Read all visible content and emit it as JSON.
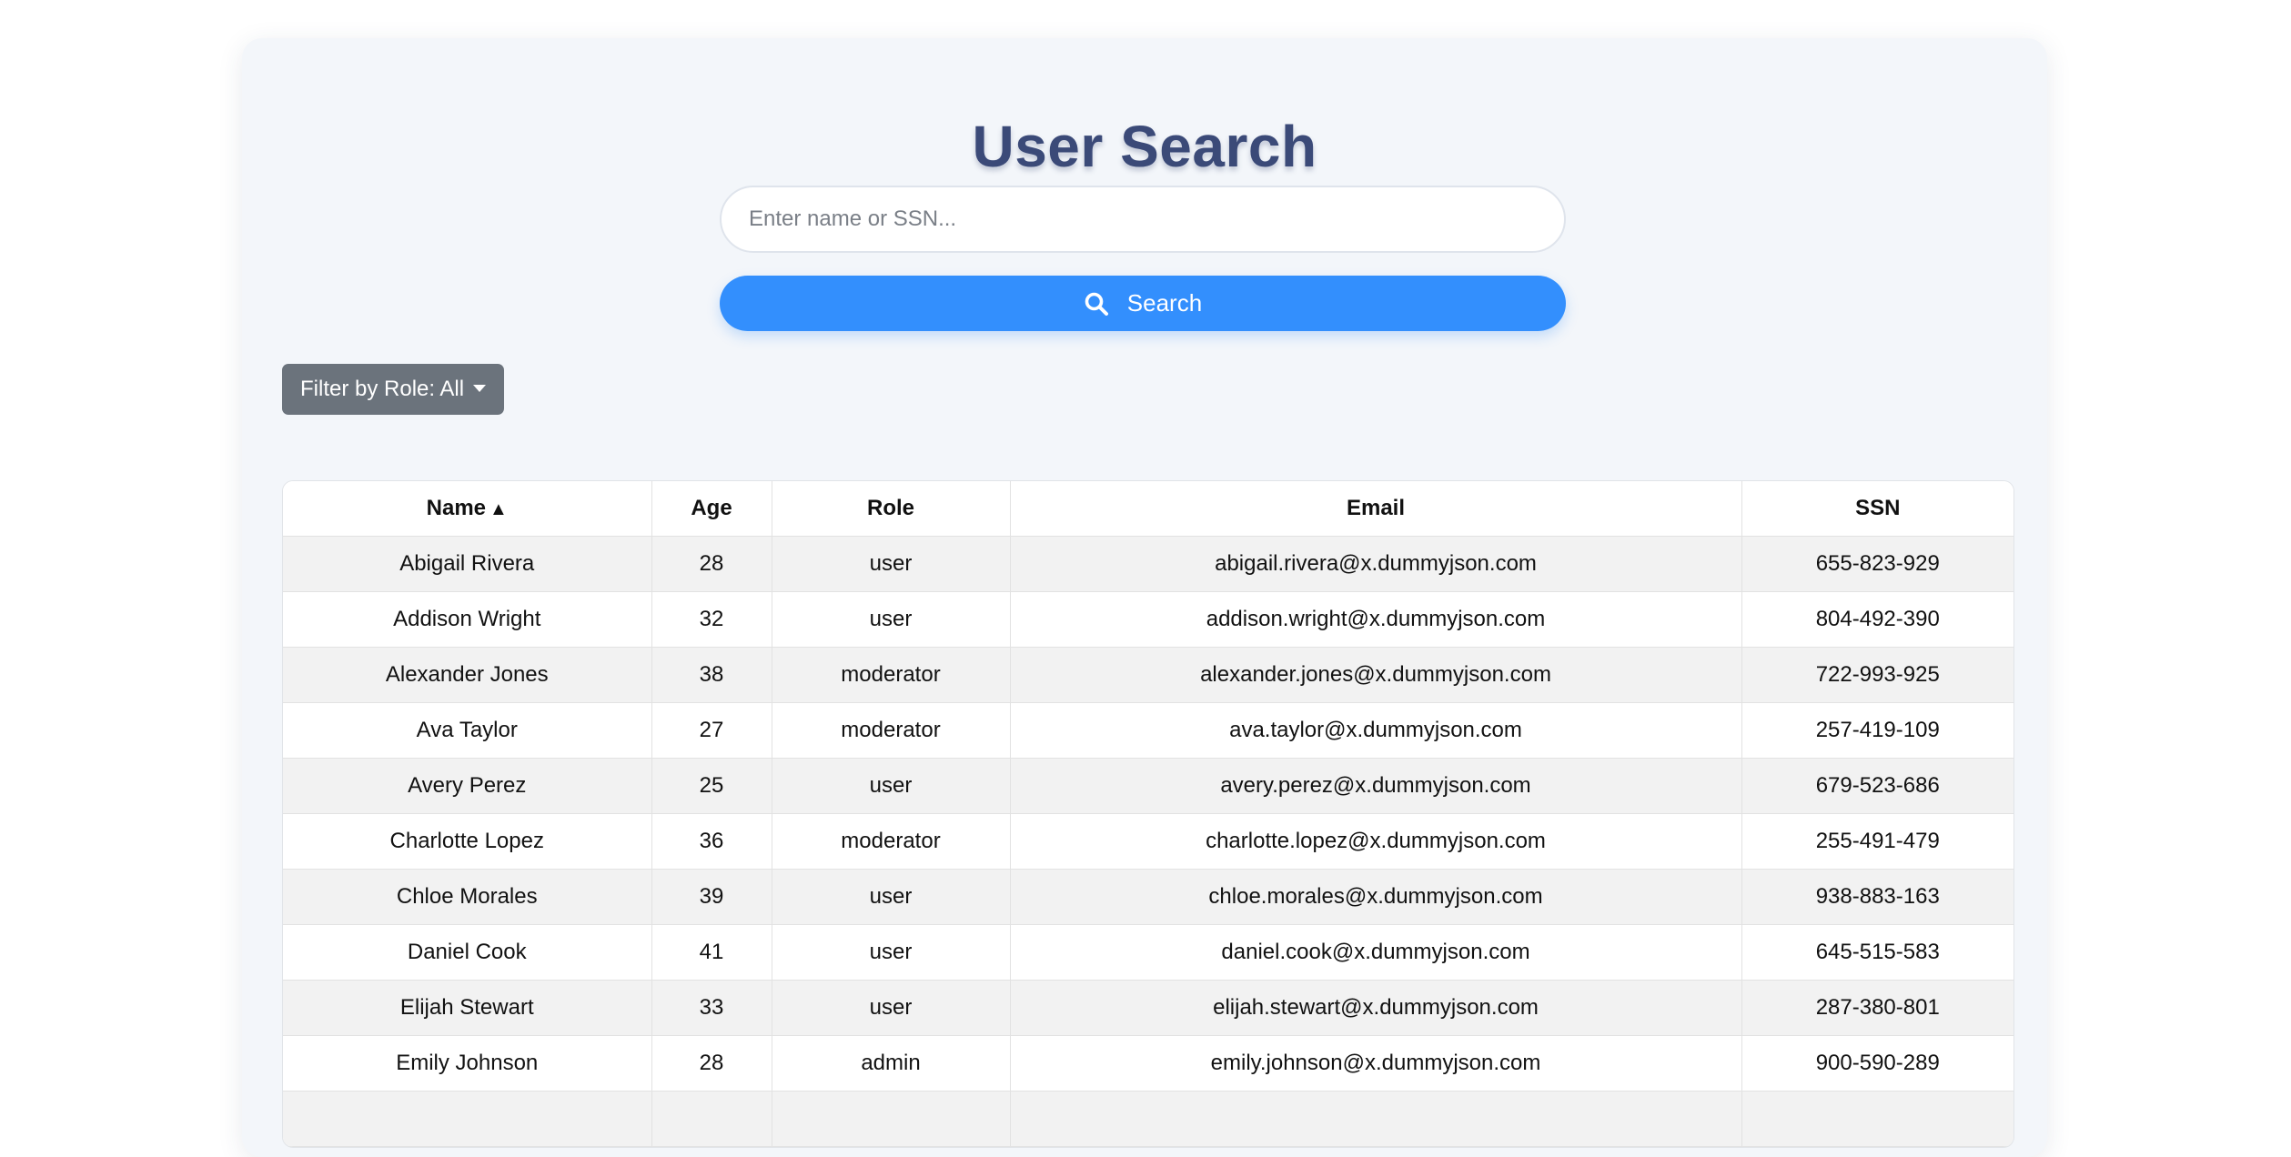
{
  "page": {
    "title": "User Search"
  },
  "search": {
    "placeholder": "Enter name or SSN...",
    "value": "",
    "button_label": "Search",
    "icon": "search-icon"
  },
  "filter": {
    "label": "Filter by Role: All"
  },
  "table": {
    "columns": [
      {
        "label": "Name",
        "sort": "▲"
      },
      {
        "label": "Age"
      },
      {
        "label": "Role"
      },
      {
        "label": "Email"
      },
      {
        "label": "SSN"
      }
    ],
    "rows": [
      {
        "name": "Abigail Rivera",
        "age": "28",
        "role": "user",
        "email": "abigail.rivera@x.dummyjson.com",
        "ssn": "655-823-929"
      },
      {
        "name": "Addison Wright",
        "age": "32",
        "role": "user",
        "email": "addison.wright@x.dummyjson.com",
        "ssn": "804-492-390"
      },
      {
        "name": "Alexander Jones",
        "age": "38",
        "role": "moderator",
        "email": "alexander.jones@x.dummyjson.com",
        "ssn": "722-993-925"
      },
      {
        "name": "Ava Taylor",
        "age": "27",
        "role": "moderator",
        "email": "ava.taylor@x.dummyjson.com",
        "ssn": "257-419-109"
      },
      {
        "name": "Avery Perez",
        "age": "25",
        "role": "user",
        "email": "avery.perez@x.dummyjson.com",
        "ssn": "679-523-686"
      },
      {
        "name": "Charlotte Lopez",
        "age": "36",
        "role": "moderator",
        "email": "charlotte.lopez@x.dummyjson.com",
        "ssn": "255-491-479"
      },
      {
        "name": "Chloe Morales",
        "age": "39",
        "role": "user",
        "email": "chloe.morales@x.dummyjson.com",
        "ssn": "938-883-163"
      },
      {
        "name": "Daniel Cook",
        "age": "41",
        "role": "user",
        "email": "daniel.cook@x.dummyjson.com",
        "ssn": "645-515-583"
      },
      {
        "name": "Elijah Stewart",
        "age": "33",
        "role": "user",
        "email": "elijah.stewart@x.dummyjson.com",
        "ssn": "287-380-801"
      },
      {
        "name": "Emily Johnson",
        "age": "28",
        "role": "admin",
        "email": "emily.johnson@x.dummyjson.com",
        "ssn": "900-590-289"
      },
      {
        "name": "",
        "age": "",
        "role": "",
        "email": "",
        "ssn": ""
      }
    ]
  },
  "colors": {
    "title": "#3b4a78",
    "accent": "#338ffd",
    "filter_button": "#6b737c",
    "card_background": "#f3f6fa",
    "row_stripe": "#f2f2f2"
  }
}
